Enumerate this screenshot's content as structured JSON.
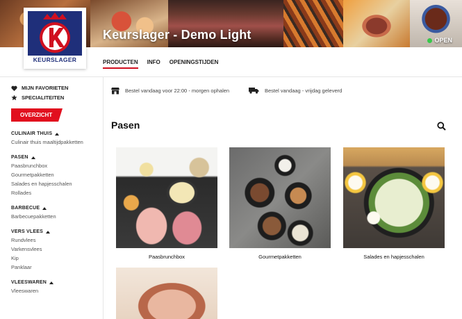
{
  "header": {
    "store_name": "Keurslager - Demo Light",
    "logo_text": "KEURSLAGER",
    "status": "OPEN",
    "tabs": [
      {
        "label": "PRODUCTEN",
        "active": true
      },
      {
        "label": "INFO",
        "active": false
      },
      {
        "label": "OPENINGSTIJDEN",
        "active": false
      }
    ]
  },
  "info": {
    "pickup": "Bestel vandaag voor 22:00 - morgen ophalen",
    "delivery": "Bestel vandaag - vrijdag geleverd"
  },
  "sidebar": {
    "favorites": "MIJN FAVORIETEN",
    "specialties": "SPECIALITEITEN",
    "overview_button": "OVERZICHT",
    "categories": [
      {
        "title": "CULINAIR THUIS",
        "items": [
          "Culinair thuis maaltijdpakketten"
        ]
      },
      {
        "title": "PASEN",
        "items": [
          "Paasbrunchbox",
          "Gourmetpakketten",
          "Salades en hapjesschalen",
          "Rollades"
        ]
      },
      {
        "title": "BARBECUE",
        "items": [
          "Barbecuepakketten"
        ]
      },
      {
        "title": "VERS VLEES",
        "items": [
          "Rundvlees",
          "Varkensvlees",
          "Kip",
          "Panklaar"
        ]
      },
      {
        "title": "VLEESWAREN",
        "items": [
          "Vleeswaren"
        ]
      }
    ]
  },
  "main": {
    "title": "Pasen",
    "products": [
      {
        "name": "Paasbrunchbox"
      },
      {
        "name": "Gourmetpakketten"
      },
      {
        "name": "Salades en hapjesschalen"
      },
      {
        "name": ""
      }
    ]
  },
  "colors": {
    "accent": "#e10f1e",
    "logo_blue": "#1f2f7a",
    "open_dot": "#37c84a"
  }
}
